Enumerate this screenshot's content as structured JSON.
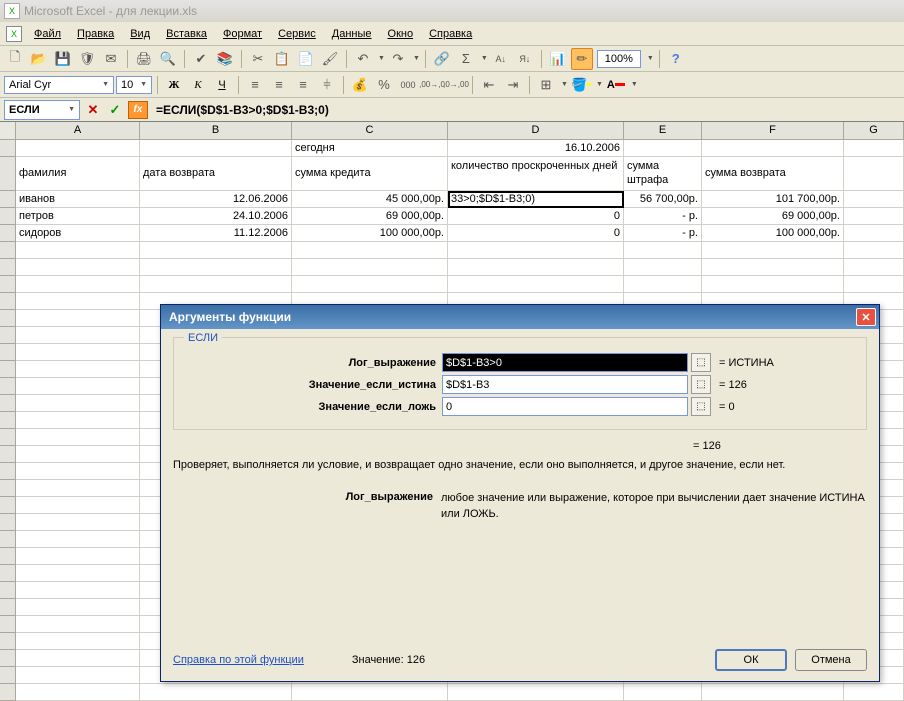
{
  "titlebar": {
    "text": "Microsoft Excel - для лекции.xls"
  },
  "menu": {
    "file": "Файл",
    "edit": "Правка",
    "view": "Вид",
    "insert": "Вставка",
    "format": "Формат",
    "tools": "Сервис",
    "data": "Данные",
    "window": "Окно",
    "help": "Справка"
  },
  "toolbar": {
    "zoom": "100%"
  },
  "font": {
    "name": "Arial Cyr",
    "size": "10"
  },
  "formula_bar": {
    "name_box": "ЕСЛИ",
    "formula": "=ЕСЛИ($D$1-B3>0;$D$1-B3;0)"
  },
  "columns": [
    "A",
    "B",
    "C",
    "D",
    "E",
    "F",
    "G"
  ],
  "sheet": {
    "r1": {
      "C": "сегодня",
      "D": "16.10.2006"
    },
    "r2": {
      "A": "фамилия",
      "B": "дата возврата",
      "C": "сумма кредита",
      "D": "количество проскроченных дней",
      "E": "сумма штрафа",
      "F": "сумма возврата"
    },
    "r3": {
      "A": "иванов",
      "B": "12.06.2006",
      "C": "45 000,00р.",
      "D": "33>0;$D$1-B3;0)",
      "E": "56 700,00р.",
      "F": "101 700,00р."
    },
    "r4": {
      "A": "петров",
      "B": "24.10.2006",
      "C": "69 000,00р.",
      "D": "0",
      "E": "-   р.",
      "F": "69 000,00р."
    },
    "r5": {
      "A": "сидоров",
      "B": "11.12.2006",
      "C": "100 000,00р.",
      "D": "0",
      "E": "-   р.",
      "F": "100 000,00р."
    }
  },
  "dialog": {
    "title": "Аргументы функции",
    "func": "ЕСЛИ",
    "args": {
      "a1": {
        "label": "Лог_выражение",
        "value": "$D$1-B3>0",
        "result": "= ИСТИНА"
      },
      "a2": {
        "label": "Значение_если_истина",
        "value": "$D$1-B3",
        "result": "= 126"
      },
      "a3": {
        "label": "Значение_если_ложь",
        "value": "0",
        "result": "= 0"
      }
    },
    "overall_result": "= 126",
    "desc": "Проверяет, выполняется ли условие, и возвращает одно значение, если оно выполняется, и другое значение, если нет.",
    "arg_desc_label": "Лог_выражение",
    "arg_desc_text": "любое значение или выражение, которое при вычислении дает значение ИСТИНА или ЛОЖЬ.",
    "help": "Справка по этой функции",
    "value_label": "Значение:",
    "value": "126",
    "ok": "ОК",
    "cancel": "Отмена"
  }
}
